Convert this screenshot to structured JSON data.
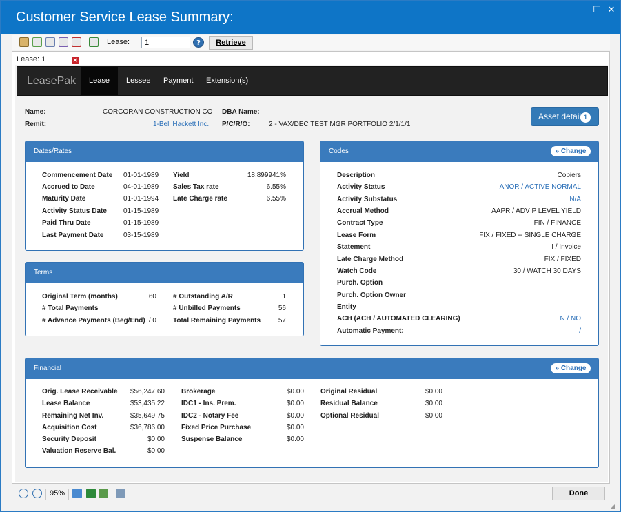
{
  "window": {
    "title": "Customer Service Lease Summary:"
  },
  "toolbar": {
    "lease_label": "Lease:",
    "lease_value": "1",
    "retrieve_label": "Retrieve",
    "help_label": "?"
  },
  "doc_tab": {
    "label": "Lease: 1"
  },
  "nav": {
    "brand": "LeasePak",
    "items": [
      "Lease",
      "Lessee",
      "Payment",
      "Extension(s)"
    ]
  },
  "header": {
    "name_label": "Name:",
    "name_value": "CORCORAN CONSTRUCTION CO",
    "remit_label": "Remit:",
    "remit_value": "1-Bell Hackett Inc.",
    "dba_label": "DBA Name:",
    "dba_value": "",
    "pcro_label": "P/C/R/O:",
    "pcro_value": "2 - VAX/DEC TEST MGR PORTFOLIO 2/1/1/1",
    "asset_button": "Asset detail",
    "asset_count": "1"
  },
  "dates": {
    "title": "Dates/Rates",
    "left": [
      {
        "label": "Commencement Date",
        "value": "01-01-1989"
      },
      {
        "label": "Accrued to Date",
        "value": "04-01-1989"
      },
      {
        "label": "Maturity Date",
        "value": "01-01-1994"
      },
      {
        "label": "Activity Status Date",
        "value": "01-15-1989"
      },
      {
        "label": "Paid Thru Date",
        "value": "01-15-1989"
      },
      {
        "label": "Last Payment Date",
        "value": "03-15-1989"
      }
    ],
    "right": [
      {
        "label": "Yield",
        "value": "18.899941%"
      },
      {
        "label": "Sales Tax rate",
        "value": "6.55%"
      },
      {
        "label": "Late Charge rate",
        "value": "6.55%"
      }
    ]
  },
  "terms": {
    "title": "Terms",
    "left": [
      {
        "label": "Original Term (months)",
        "value": "60"
      },
      {
        "label": "# Total Payments",
        "value": ""
      },
      {
        "label": "# Advance Payments (Beg/End)",
        "value": "1 / 0"
      }
    ],
    "right": [
      {
        "label": "# Outstanding A/R",
        "value": "1"
      },
      {
        "label": "# Unbilled Payments",
        "value": "56"
      },
      {
        "label": "Total Remaining Payments",
        "value": "57"
      }
    ]
  },
  "codes": {
    "title": "Codes",
    "change_label": "» Change",
    "rows": [
      {
        "label": "Description",
        "value": "Copiers",
        "link": false
      },
      {
        "label": "Activity Status",
        "value": "ANOR / ACTIVE NORMAL",
        "link": true
      },
      {
        "label": "Activity Substatus",
        "value": "N/A",
        "link": true
      },
      {
        "label": "Accrual Method",
        "value": "AAPR / ADV P LEVEL YIELD",
        "link": false
      },
      {
        "label": "Contract Type",
        "value": "FIN / FINANCE",
        "link": false
      },
      {
        "label": "Lease Form",
        "value": "FIX / FIXED -- SINGLE CHARGE",
        "link": false
      },
      {
        "label": "Statement",
        "value": "I / Invoice",
        "link": false
      },
      {
        "label": "Late Charge Method",
        "value": "FIX / FIXED",
        "link": false
      },
      {
        "label": "Watch Code",
        "value": "30 / WATCH 30 DAYS",
        "link": false
      },
      {
        "label": "Purch. Option",
        "value": "",
        "link": false
      },
      {
        "label": "Purch. Option Owner",
        "value": "",
        "link": false
      },
      {
        "label": "Entity",
        "value": "",
        "link": false
      },
      {
        "label": "ACH (ACH / AUTOMATED CLEARING)",
        "value": "N / NO",
        "link": true
      },
      {
        "label": "Automatic Payment:",
        "value": "/",
        "link": true
      }
    ]
  },
  "financial": {
    "title": "Financial",
    "change_label": "» Change",
    "col1": [
      {
        "label": "Orig. Lease Receivable",
        "value": "$56,247.60"
      },
      {
        "label": "Lease Balance",
        "value": "$53,435.22"
      },
      {
        "label": "Remaining Net Inv.",
        "value": "$35,649.75"
      },
      {
        "label": "Acquisition Cost",
        "value": "$36,786.00"
      },
      {
        "label": "Security Deposit",
        "value": "$0.00"
      },
      {
        "label": "Valuation Reserve Bal.",
        "value": "$0.00"
      }
    ],
    "col2": [
      {
        "label": "Brokerage",
        "value": "$0.00"
      },
      {
        "label": "IDC1 - Ins. Prem.",
        "value": "$0.00"
      },
      {
        "label": "IDC2 - Notary Fee",
        "value": "$0.00"
      },
      {
        "label": "Fixed Price Purchase",
        "value": "$0.00"
      },
      {
        "label": "Suspense Balance",
        "value": "$0.00"
      }
    ],
    "col3": [
      {
        "label": "Original Residual",
        "value": "$0.00"
      },
      {
        "label": "Residual Balance",
        "value": "$0.00"
      },
      {
        "label": "Optional Residual",
        "value": "$0.00"
      }
    ]
  },
  "statusbar": {
    "zoom": "95%",
    "done_label": "Done"
  }
}
